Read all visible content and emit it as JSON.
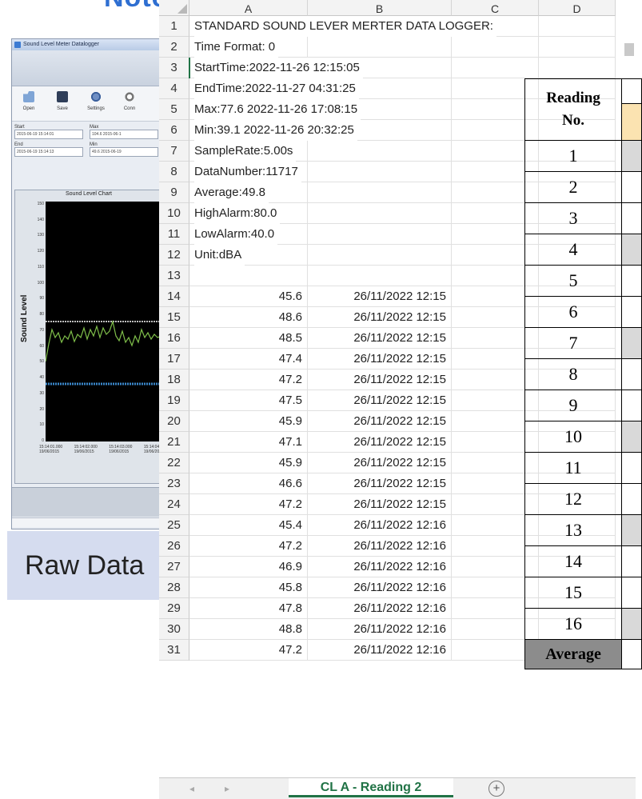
{
  "page_heading": "Note",
  "software": {
    "window_title": "Sound Level Meter Datalogger",
    "toolbar": [
      {
        "label": "Open",
        "icon": "folder-open-icon"
      },
      {
        "label": "Save",
        "icon": "save-icon"
      },
      {
        "label": "Settings",
        "icon": "settings-gear-icon"
      },
      {
        "label": "Conn",
        "icon": "connect-icon"
      }
    ],
    "fields": {
      "start_label": "Start",
      "start_value": "2015-06-19 15:14:01",
      "max_label": "Max",
      "max_value": "104.6 2015-06-1",
      "end_label": "End",
      "end_value": "2015-06-19 15:14:13",
      "min_label": "Min",
      "min_value": "49.6 2015-06-19"
    },
    "chart": {
      "title": "Sound Level Chart",
      "ylabel": "Sound Level",
      "yticks": [
        "150",
        "140",
        "130",
        "120",
        "110",
        "100",
        "90",
        "80",
        "70",
        "60",
        "50",
        "40",
        "30",
        "20",
        "10",
        "0"
      ],
      "xticks": [
        "15:14:01.000\n19/06/2015",
        "15:14:02.000\n19/06/2015",
        "15:14:03.000\n19/06/2015",
        "15:14:04.000\n19/06/2015"
      ]
    }
  },
  "raw_label": "Raw Data",
  "spreadsheet": {
    "columns": [
      "A",
      "B",
      "C",
      "D"
    ],
    "header_rows": [
      {
        "row": "1",
        "text": "STANDARD SOUND LEVER MERTER DATA LOGGER:"
      },
      {
        "row": "2",
        "text": "Time Format: 0"
      },
      {
        "row": "3",
        "text": "StartTime:2022-11-26 12:15:05"
      },
      {
        "row": "4",
        "text": "EndTime:2022-11-27  04:31:25"
      },
      {
        "row": "5",
        "text": "Max:77.6 2022-11-26  17:08:15"
      },
      {
        "row": "6",
        "text": "Min:39.1 2022-11-26  20:32:25"
      },
      {
        "row": "7",
        "text": "SampleRate:5.00s"
      },
      {
        "row": "8",
        "text": "DataNumber:11717"
      },
      {
        "row": "9",
        "text": "Average:49.8"
      },
      {
        "row": "10",
        "text": "HighAlarm:80.0"
      },
      {
        "row": "11",
        "text": "LowAlarm:40.0"
      },
      {
        "row": "12",
        "text": "Unit:dBA"
      },
      {
        "row": "13",
        "text": ""
      }
    ],
    "data_rows": [
      {
        "row": "14",
        "value": "45.6",
        "time": "26/11/2022 12:15"
      },
      {
        "row": "15",
        "value": "48.6",
        "time": "26/11/2022 12:15"
      },
      {
        "row": "16",
        "value": "48.5",
        "time": "26/11/2022 12:15"
      },
      {
        "row": "17",
        "value": "47.4",
        "time": "26/11/2022 12:15"
      },
      {
        "row": "18",
        "value": "47.2",
        "time": "26/11/2022 12:15"
      },
      {
        "row": "19",
        "value": "47.5",
        "time": "26/11/2022 12:15"
      },
      {
        "row": "20",
        "value": "45.9",
        "time": "26/11/2022 12:15"
      },
      {
        "row": "21",
        "value": "47.1",
        "time": "26/11/2022 12:15"
      },
      {
        "row": "22",
        "value": "45.9",
        "time": "26/11/2022 12:15"
      },
      {
        "row": "23",
        "value": "46.6",
        "time": "26/11/2022 12:15"
      },
      {
        "row": "24",
        "value": "47.2",
        "time": "26/11/2022 12:15"
      },
      {
        "row": "25",
        "value": "45.4",
        "time": "26/11/2022 12:16"
      },
      {
        "row": "26",
        "value": "47.2",
        "time": "26/11/2022 12:16"
      },
      {
        "row": "27",
        "value": "46.9",
        "time": "26/11/2022 12:16"
      },
      {
        "row": "28",
        "value": "45.8",
        "time": "26/11/2022 12:16"
      },
      {
        "row": "29",
        "value": "47.8",
        "time": "26/11/2022 12:16"
      },
      {
        "row": "30",
        "value": "48.8",
        "time": "26/11/2022 12:16"
      },
      {
        "row": "31",
        "value": "47.2",
        "time": "26/11/2022 12:16"
      }
    ],
    "active_sheet_tab": "CL A - Reading 2",
    "add_sheet_symbol": "+"
  },
  "reading_table": {
    "header": "Reading No.",
    "numbers": [
      "1",
      "2",
      "3",
      "4",
      "5",
      "6",
      "7",
      "8",
      "9",
      "10",
      "11",
      "12",
      "13",
      "14",
      "15",
      "16"
    ],
    "footer": "Average"
  }
}
